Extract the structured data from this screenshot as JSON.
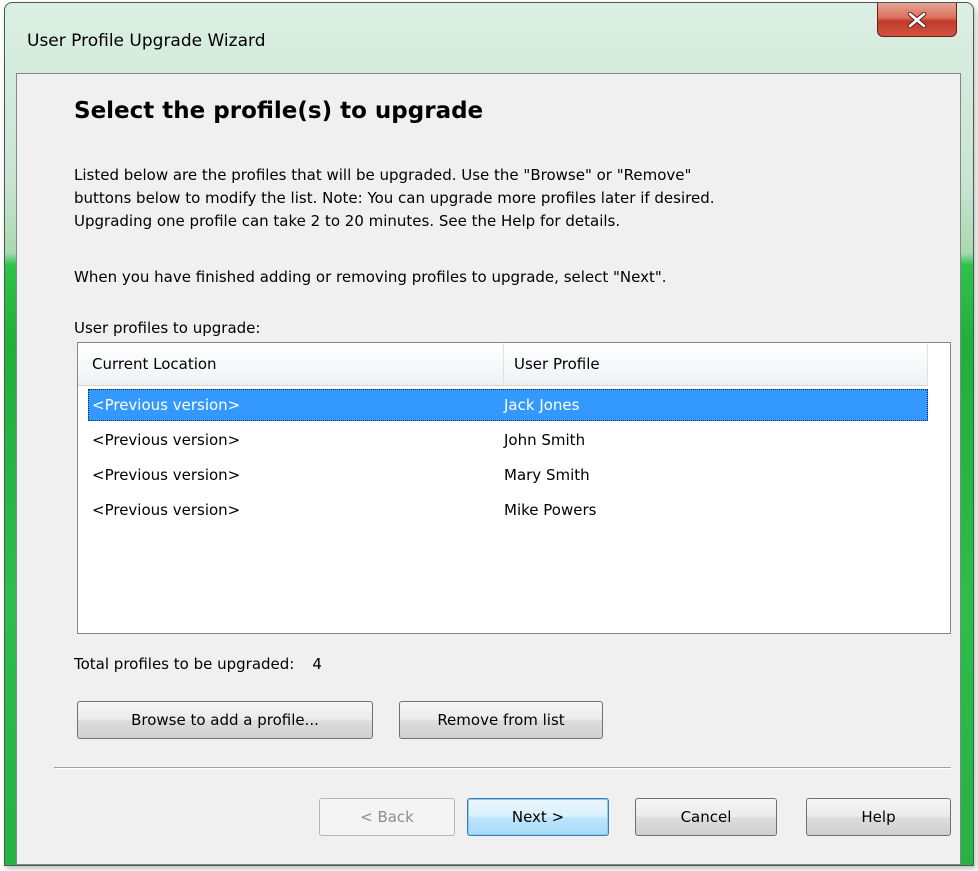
{
  "window": {
    "title": "User Profile Upgrade Wizard",
    "close_icon": "close-icon"
  },
  "page": {
    "heading": "Select the profile(s) to upgrade",
    "intro_lines": [
      "Listed below are the profiles that will be upgraded. Use the \"Browse\" or \"Remove\"",
      "buttons below to modify the list. Note: You can upgrade more profiles later if desired.",
      "Upgrading one profile can take 2 to 20 minutes. See the Help for details."
    ],
    "finish_text": "When you have finished adding or removing profiles to upgrade, select \"Next\".",
    "list_label": "User profiles to upgrade:"
  },
  "profiles_table": {
    "columns": [
      "Current Location",
      "User Profile"
    ],
    "rows": [
      {
        "location": "<Previous version>",
        "profile": "Jack Jones",
        "selected": true
      },
      {
        "location": "<Previous version>",
        "profile": "John Smith",
        "selected": false
      },
      {
        "location": "<Previous version>",
        "profile": "Mary Smith",
        "selected": false
      },
      {
        "location": "<Previous version>",
        "profile": "Mike Powers",
        "selected": false
      }
    ],
    "selection_color": "#3399ff"
  },
  "summary": {
    "total_label": "Total profiles to be upgraded:",
    "total_count": "4"
  },
  "actions": {
    "browse_label": "Browse to add a profile...",
    "remove_label": "Remove from list"
  },
  "nav": {
    "back_label": "< Back",
    "next_label": "Next >",
    "cancel_label": "Cancel",
    "help_label": "Help"
  },
  "colors": {
    "frame_accent": "#25b342",
    "close_button": "#c0392b",
    "client_background": "#f0f0f0"
  }
}
